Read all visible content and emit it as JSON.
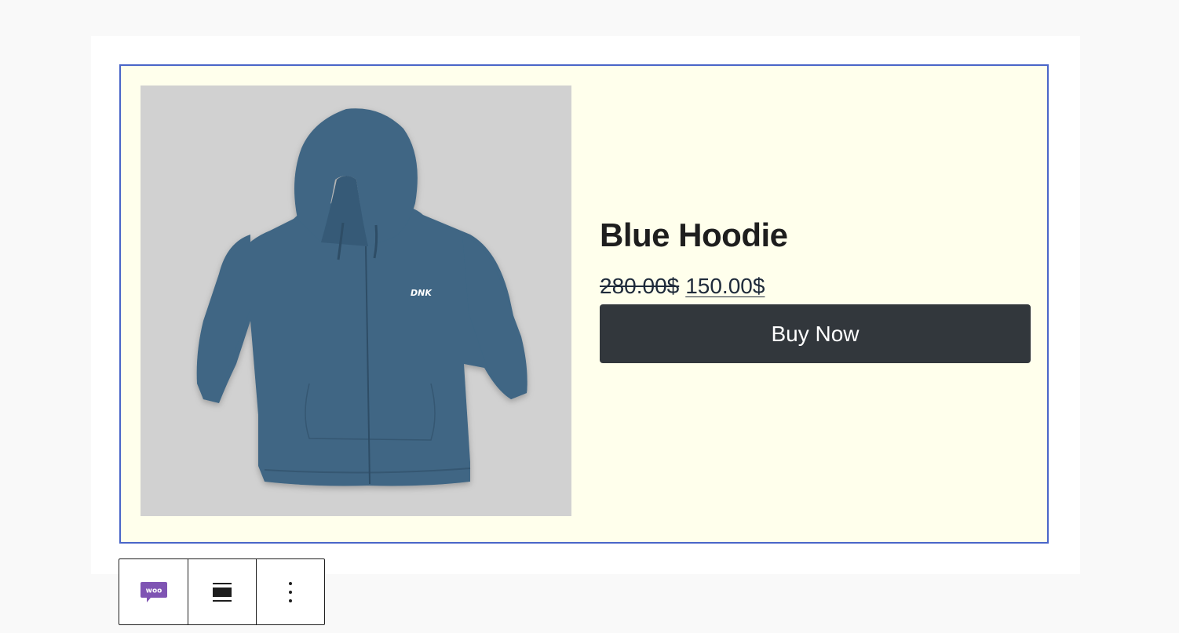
{
  "product": {
    "title": "Blue Hoodie",
    "regular_price": "280.00$",
    "sale_price": "150.00$",
    "button_label": "Buy Now",
    "image": {
      "icon": "hoodie-image",
      "logo_text": "DNK",
      "background": "#d1d1d1",
      "garment_color": "#3f6684"
    }
  },
  "toolbar": {
    "buttons": [
      {
        "icon": "woo-icon",
        "label": "woo"
      },
      {
        "icon": "align-icon"
      },
      {
        "icon": "more-options-icon"
      }
    ]
  },
  "colors": {
    "block_background": "#ffffec",
    "block_border": "#4a66c8",
    "button_background": "#32373c",
    "woo_purple": "#7f54b3"
  }
}
